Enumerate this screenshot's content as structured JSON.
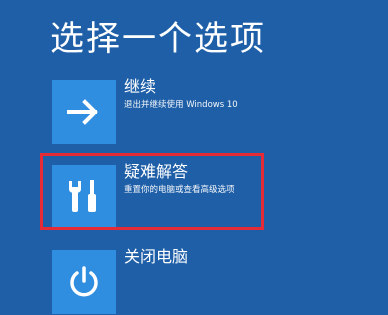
{
  "title": "选择一个选项",
  "options": [
    {
      "label": "继续",
      "description": "退出并继续使用 Windows 10",
      "icon": "arrow-right-icon"
    },
    {
      "label": "疑难解答",
      "description": "重置你的电脑或查看高级选项",
      "icon": "tools-icon"
    },
    {
      "label": "关闭电脑",
      "description": "",
      "icon": "power-icon"
    }
  ],
  "colors": {
    "background": "#1e5fa8",
    "tile": "#2f8ee0",
    "highlight": "#e52b36"
  }
}
